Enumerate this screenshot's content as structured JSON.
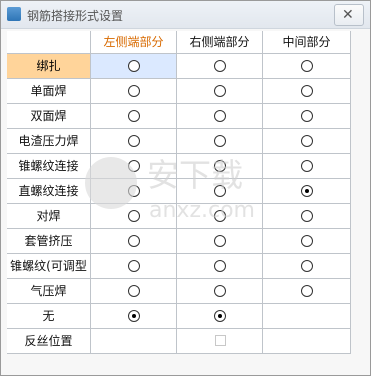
{
  "window": {
    "title": "钢筋搭接形式设置"
  },
  "table": {
    "columns": [
      "左侧端部分",
      "右侧端部分",
      "中间部分"
    ],
    "rows": [
      {
        "label": "绑扎",
        "values": [
          false,
          false,
          false
        ]
      },
      {
        "label": "单面焊",
        "values": [
          false,
          false,
          false
        ]
      },
      {
        "label": "双面焊",
        "values": [
          false,
          false,
          false
        ]
      },
      {
        "label": "电渣压力焊",
        "values": [
          false,
          false,
          false
        ]
      },
      {
        "label": "锥螺纹连接",
        "values": [
          false,
          false,
          false
        ]
      },
      {
        "label": "直螺纹连接",
        "values": [
          false,
          false,
          true
        ]
      },
      {
        "label": "对焊",
        "values": [
          false,
          false,
          false
        ]
      },
      {
        "label": "套管挤压",
        "values": [
          false,
          false,
          false
        ]
      },
      {
        "label": "锥螺纹(可调型",
        "values": [
          false,
          false,
          false
        ]
      },
      {
        "label": "气压焊",
        "values": [
          false,
          false,
          false
        ]
      },
      {
        "label": "无",
        "values": [
          true,
          true,
          null
        ]
      },
      {
        "label": "反丝位置",
        "values": [
          null,
          "checkbox",
          null
        ]
      }
    ]
  },
  "watermark": {
    "text": "安下载",
    "domain": "anxz.com"
  },
  "colors": {
    "active_header": "#d86a00",
    "active_row": "#ffd49a",
    "selected_cell": "#dbe9ff"
  }
}
